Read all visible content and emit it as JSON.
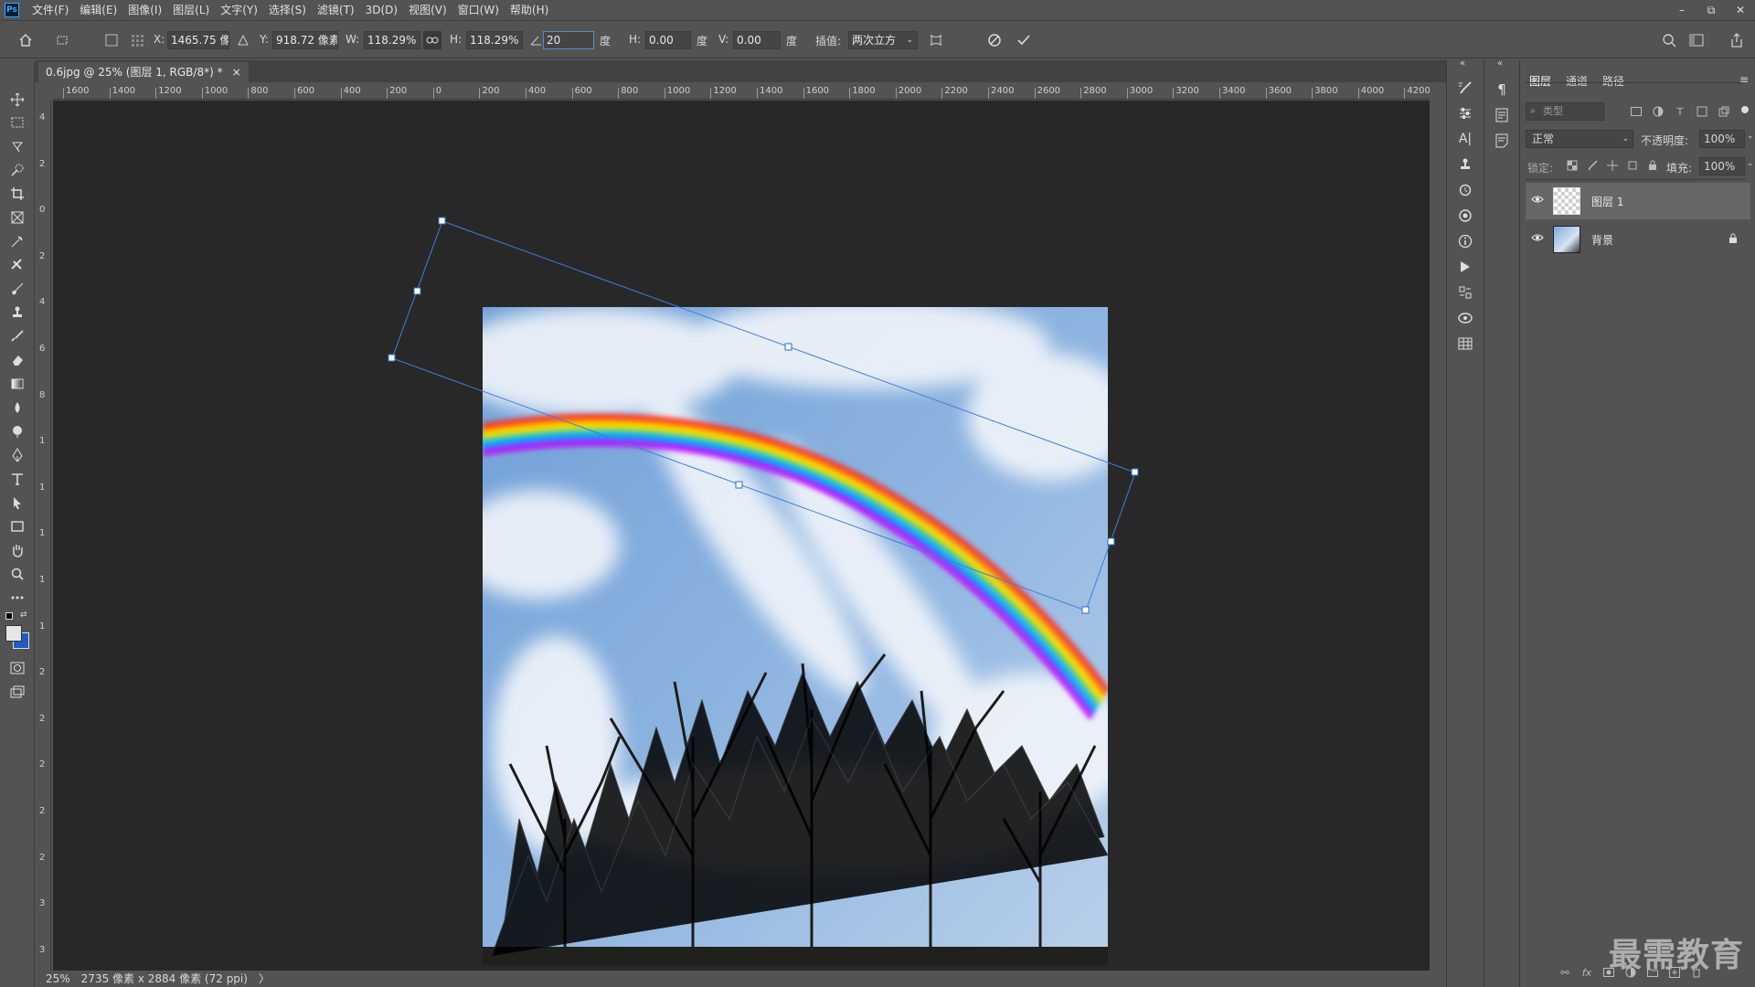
{
  "app": {
    "logo": "Ps"
  },
  "menu": [
    "文件(F)",
    "编辑(E)",
    "图像(I)",
    "图层(L)",
    "文字(Y)",
    "选择(S)",
    "滤镜(T)",
    "3D(D)",
    "视图(V)",
    "窗口(W)",
    "帮助(H)"
  ],
  "window_controls": {
    "minimize": "–",
    "restore": "⧉",
    "close": "✕"
  },
  "options": {
    "x_label": "X:",
    "x_value": "1465.75 像",
    "y_label": "Y:",
    "y_value": "918.72 像素",
    "w_label": "W:",
    "w_value": "118.29%",
    "h_label": "H:",
    "h_value": "118.29%",
    "angle_value": "20",
    "angle_unit": "度",
    "hskew_label": "H:",
    "hskew_value": "0.00",
    "hskew_unit": "度",
    "vskew_label": "V:",
    "vskew_value": "0.00",
    "vskew_unit": "度",
    "interp_label": "插值:",
    "interp_value": "两次立方"
  },
  "document": {
    "tab_title": "0.6jpg @ 25% (图层 1, RGB/8*) *",
    "tab_close": "×"
  },
  "rulers": {
    "top": [
      "1600",
      "1400",
      "1200",
      "1000",
      "800",
      "600",
      "400",
      "200",
      "0",
      "200",
      "400",
      "600",
      "800",
      "1000",
      "1200",
      "1400",
      "1600",
      "1800",
      "2000",
      "2200",
      "2400",
      "2600",
      "2800",
      "3000",
      "3200",
      "3400",
      "3600",
      "3800",
      "4000",
      "4200"
    ],
    "left": [
      "4",
      "2",
      "0",
      "2",
      "4",
      "6",
      "8",
      "1",
      "1",
      "1",
      "1",
      "1",
      "2",
      "2",
      "2",
      "2",
      "2",
      "3",
      "3"
    ]
  },
  "status": {
    "zoom": "25%",
    "doc_size": "2735 像素 x 2884 像素 (72 ppi)",
    "arrow": "〉"
  },
  "layers_panel": {
    "tabs": [
      "图层",
      "通道",
      "路径"
    ],
    "filter_placeholder": "类型",
    "blend_mode": "正常",
    "opacity_label": "不透明度:",
    "opacity_value": "100%",
    "lock_label": "锁定:",
    "fill_label": "填充:",
    "fill_value": "100%",
    "layers": [
      {
        "name": "图层 1",
        "selected": true,
        "locked": false
      },
      {
        "name": "背景",
        "selected": false,
        "locked": true
      }
    ]
  },
  "watermark": "最需教育",
  "colors": {
    "accent": "#31a8ff",
    "canvas_bg": "#282828",
    "panel_bg": "#535353",
    "selected_layer": "#676767",
    "foreground_swatch": "#e6e6e6",
    "background_swatch": "#1f5bbd"
  }
}
